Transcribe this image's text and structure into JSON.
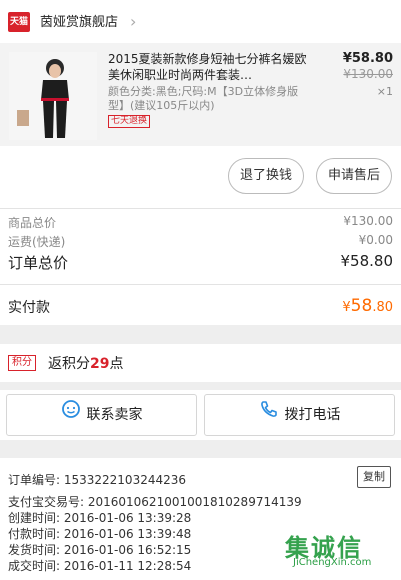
{
  "store": {
    "logo_text": "天猫",
    "name": "茵娅赏旗舰店"
  },
  "product": {
    "title": "2015夏装新款修身短袖七分裤名媛欧美休闲职业时尚两件套装…",
    "sku": "颜色分类:黑色;尺码:M【3D立体修身版型】(建议105斤以内)",
    "badge": "七天退换",
    "price": "¥58.80",
    "original_price": "¥130.00",
    "quantity": "×1"
  },
  "actions": {
    "exchange": "退了换钱",
    "after_sale": "申请售后"
  },
  "totals": {
    "goods_label": "商品总价",
    "goods_value": "¥130.00",
    "shipping_label": "运费(快递)",
    "shipping_value": "¥0.00",
    "order_label": "订单总价",
    "order_value": "¥58.80",
    "paid_label": "实付款",
    "paid_symbol": "¥",
    "paid_int": "58",
    "paid_dec": ".80"
  },
  "points": {
    "badge": "积分",
    "prefix": "返积分",
    "value": "29",
    "suffix": "点"
  },
  "contact": {
    "seller": "联系卖家",
    "phone": "拨打电话"
  },
  "order_info": {
    "order_no": "订单编号: 1533222103244236",
    "copy": "复制",
    "alipay_no": "支付宝交易号: 2016010621001001810289714139",
    "created": "创建时间: 2016-01-06 13:39:28",
    "paid": "付款时间: 2016-01-06 13:39:48",
    "shipped": "发货时间: 2016-01-06 16:52:15",
    "completed": "成交时间: 2016-01-11 12:28:54"
  },
  "watermark": {
    "text": "集诚信",
    "sub": "JiChengXin.com"
  },
  "colors": {
    "brand_red": "#d8222b",
    "accent_orange": "#ff6a00",
    "watermark_green": "#2b9e45"
  }
}
